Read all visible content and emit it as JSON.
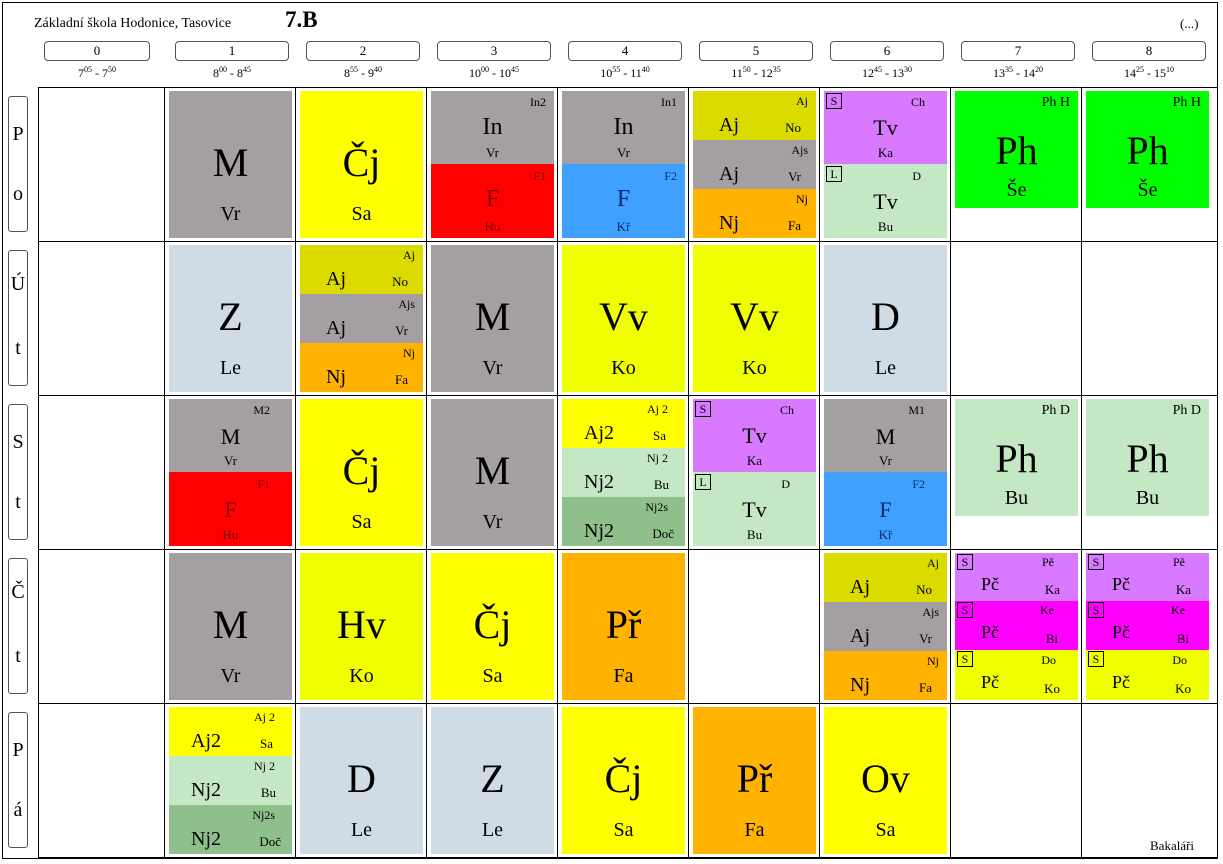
{
  "header": {
    "school": "Základní škola Hodonice, Tasovice",
    "class_name": "7.B",
    "more_link": "(...)"
  },
  "hours": [
    {
      "num": "0",
      "start_h": "7",
      "start_m": "05",
      "end_h": "7",
      "end_m": "50"
    },
    {
      "num": "1",
      "start_h": "8",
      "start_m": "00",
      "end_h": "8",
      "end_m": "45"
    },
    {
      "num": "2",
      "start_h": "8",
      "start_m": "55",
      "end_h": "9",
      "end_m": "40"
    },
    {
      "num": "3",
      "start_h": "10",
      "start_m": "00",
      "end_h": "10",
      "end_m": "45"
    },
    {
      "num": "4",
      "start_h": "10",
      "start_m": "55",
      "end_h": "11",
      "end_m": "40"
    },
    {
      "num": "5",
      "start_h": "11",
      "start_m": "50",
      "end_h": "12",
      "end_m": "35"
    },
    {
      "num": "6",
      "start_h": "12",
      "start_m": "45",
      "end_h": "13",
      "end_m": "30"
    },
    {
      "num": "7",
      "start_h": "13",
      "start_m": "35",
      "end_h": "14",
      "end_m": "20"
    },
    {
      "num": "8",
      "start_h": "14",
      "start_m": "25",
      "end_h": "15",
      "end_m": "10"
    }
  ],
  "days": [
    {
      "l1": "P",
      "l2": "o"
    },
    {
      "l1": "Ú",
      "l2": "t"
    },
    {
      "l1": "S",
      "l2": "t"
    },
    {
      "l1": "Č",
      "l2": "t"
    },
    {
      "l1": "P",
      "l2": "á"
    }
  ],
  "colors": {
    "gray": "#a39fa3",
    "yellow": "#ffff00",
    "lightyellow": "#f0ff00",
    "olive": "#dbdb00",
    "orange": "#ffb300",
    "red": "#ff0000",
    "blue": "#40a0ff",
    "purple": "#d879ff",
    "magenta": "#ff00ff",
    "palegreen": "#c4e8c4",
    "green": "#00ff00",
    "darkgreen": "#8fbf8a",
    "lightblue": "#cfdce6"
  },
  "lessons": {
    "po": {
      "h1": {
        "subject": "M",
        "teacher": "Vr"
      },
      "h2": {
        "subject": "Čj",
        "teacher": "Sa"
      },
      "h3": {
        "a": {
          "group": "In2",
          "subject": "In",
          "teacher": "Vr"
        },
        "b": {
          "group": "F1",
          "subject": "F",
          "teacher": "Hu"
        }
      },
      "h4": {
        "a": {
          "group": "In1",
          "subject": "In",
          "teacher": "Vr"
        },
        "b": {
          "group": "F2",
          "subject": "F",
          "teacher": "Kř"
        }
      },
      "h5": {
        "a": {
          "group": "Aj",
          "subject": "Aj",
          "teacher": "No"
        },
        "b": {
          "group": "Ajs",
          "subject": "Aj",
          "teacher": "Vr"
        },
        "c": {
          "group": "Nj",
          "subject": "Nj",
          "teacher": "Fa"
        }
      },
      "h6": {
        "a": {
          "tag": "S",
          "group": "Ch",
          "subject": "Tv",
          "teacher": "Ka"
        },
        "b": {
          "tag": "L",
          "group": "D",
          "subject": "Tv",
          "teacher": "Bu"
        }
      },
      "h7": {
        "group": "Ph H",
        "subject": "Ph",
        "teacher": "Še"
      },
      "h8": {
        "group": "Ph H",
        "subject": "Ph",
        "teacher": "Še"
      }
    },
    "ut": {
      "h1": {
        "subject": "Z",
        "teacher": "Le"
      },
      "h2": {
        "a": {
          "group": "Aj",
          "subject": "Aj",
          "teacher": "No"
        },
        "b": {
          "group": "Ajs",
          "subject": "Aj",
          "teacher": "Vr"
        },
        "c": {
          "group": "Nj",
          "subject": "Nj",
          "teacher": "Fa"
        }
      },
      "h3": {
        "subject": "M",
        "teacher": "Vr"
      },
      "h4": {
        "subject": "Vv",
        "teacher": "Ko"
      },
      "h5": {
        "subject": "Vv",
        "teacher": "Ko"
      },
      "h6": {
        "subject": "D",
        "teacher": "Le"
      }
    },
    "st": {
      "h1": {
        "a": {
          "group": "M2",
          "subject": "M",
          "teacher": "Vr"
        },
        "b": {
          "group": "F1",
          "subject": "F",
          "teacher": "Hu"
        }
      },
      "h2": {
        "subject": "Čj",
        "teacher": "Sa"
      },
      "h3": {
        "subject": "M",
        "teacher": "Vr"
      },
      "h4": {
        "a": {
          "group": "Aj 2",
          "subject": "Aj2",
          "teacher": "Sa"
        },
        "b": {
          "group": "Nj 2",
          "subject": "Nj2",
          "teacher": "Bu"
        },
        "c": {
          "group": "Nj2s",
          "subject": "Nj2",
          "teacher": "Doč"
        }
      },
      "h5": {
        "a": {
          "tag": "S",
          "group": "Ch",
          "subject": "Tv",
          "teacher": "Ka"
        },
        "b": {
          "tag": "L",
          "group": "D",
          "subject": "Tv",
          "teacher": "Bu"
        }
      },
      "h6": {
        "a": {
          "group": "M1",
          "subject": "M",
          "teacher": "Vr"
        },
        "b": {
          "group": "F2",
          "subject": "F",
          "teacher": "Kř"
        }
      },
      "h7": {
        "group": "Ph D",
        "subject": "Ph",
        "teacher": "Bu"
      },
      "h8": {
        "group": "Ph D",
        "subject": "Ph",
        "teacher": "Bu"
      }
    },
    "ct": {
      "h1": {
        "subject": "M",
        "teacher": "Vr"
      },
      "h2": {
        "subject": "Hv",
        "teacher": "Ko"
      },
      "h3": {
        "subject": "Čj",
        "teacher": "Sa"
      },
      "h4": {
        "subject": "Př",
        "teacher": "Fa"
      },
      "h6": {
        "a": {
          "group": "Aj",
          "subject": "Aj",
          "teacher": "No"
        },
        "b": {
          "group": "Ajs",
          "subject": "Aj",
          "teacher": "Vr"
        },
        "c": {
          "group": "Nj",
          "subject": "Nj",
          "teacher": "Fa"
        }
      },
      "h7": {
        "a": {
          "tag": "S",
          "group": "Pě",
          "subject": "Pč",
          "teacher": "Ka"
        },
        "b": {
          "tag": "S",
          "group": "Ke",
          "subject": "Pč",
          "teacher": "Bi"
        },
        "c": {
          "tag": "S",
          "group": "Do",
          "subject": "Pč",
          "teacher": "Ko"
        }
      },
      "h8": {
        "a": {
          "tag": "S",
          "group": "Pě",
          "subject": "Pč",
          "teacher": "Ka"
        },
        "b": {
          "tag": "S",
          "group": "Ke",
          "subject": "Pč",
          "teacher": "Bi"
        },
        "c": {
          "tag": "S",
          "group": "Do",
          "subject": "Pč",
          "teacher": "Ko"
        }
      }
    },
    "pa": {
      "h1": {
        "a": {
          "group": "Aj 2",
          "subject": "Aj2",
          "teacher": "Sa"
        },
        "b": {
          "group": "Nj 2",
          "subject": "Nj2",
          "teacher": "Bu"
        },
        "c": {
          "group": "Nj2s",
          "subject": "Nj2",
          "teacher": "Doč"
        }
      },
      "h2": {
        "subject": "D",
        "teacher": "Le"
      },
      "h3": {
        "subject": "Z",
        "teacher": "Le"
      },
      "h4": {
        "subject": "Čj",
        "teacher": "Sa"
      },
      "h5": {
        "subject": "Př",
        "teacher": "Fa"
      },
      "h6": {
        "subject": "Ov",
        "teacher": "Sa"
      }
    }
  },
  "footer": "Bakaláři"
}
